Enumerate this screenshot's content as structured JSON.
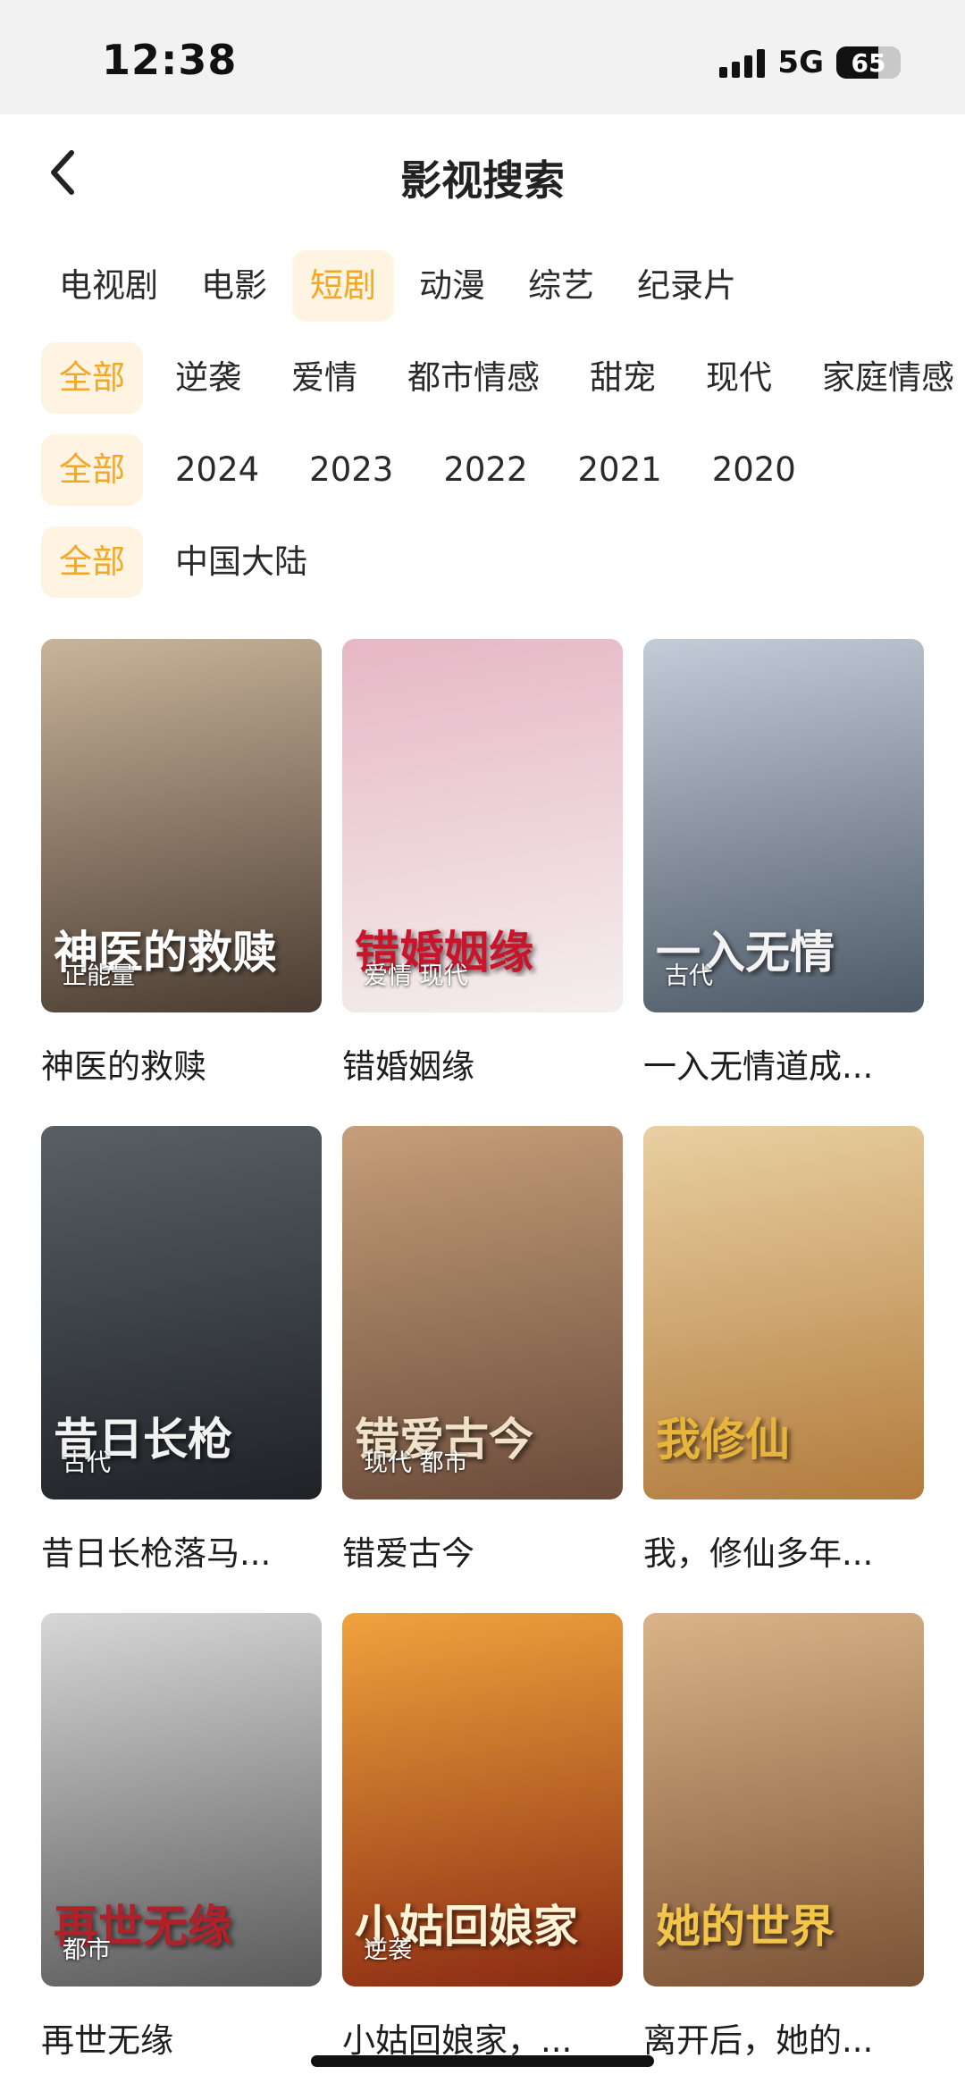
{
  "status": {
    "time": "12:38",
    "network": "5G",
    "battery": "65",
    "battery_level": 0.65
  },
  "header": {
    "title": "影视搜索",
    "back_icon": "chevron-left-icon"
  },
  "filters": {
    "category": [
      "电视剧",
      "电影",
      "短剧",
      "动漫",
      "综艺",
      "纪录片"
    ],
    "category_active": 2,
    "genre": [
      "全部",
      "逆袭",
      "爱情",
      "都市情感",
      "甜宠",
      "现代",
      "家庭情感"
    ],
    "genre_active": 0,
    "year": [
      "全部",
      "2024",
      "2023",
      "2022",
      "2021",
      "2020"
    ],
    "year_active": 0,
    "region": [
      "全部",
      "中国大陆"
    ],
    "region_active": 0
  },
  "accent_color": "#f5a623",
  "items": [
    {
      "name": "神医的救赎",
      "poster_title": "神医的救赎",
      "tag": "正能量",
      "colors": [
        "#c9b49a",
        "#4a3c32"
      ],
      "title_color": "#ffffff"
    },
    {
      "name": "错婚姻缘",
      "poster_title": "错婚姻缘",
      "tag": "爱情 现代",
      "colors": [
        "#e7b7c6",
        "#f4eeee"
      ],
      "title_color": "#c8152a"
    },
    {
      "name": "一入无情道成...",
      "poster_title": "一入无情",
      "tag": "古代",
      "colors": [
        "#c3cdd8",
        "#4d5966"
      ],
      "title_color": "#f4f4f4"
    },
    {
      "name": "昔日长枪落马...",
      "poster_title": "昔日长枪",
      "tag": "古代",
      "colors": [
        "#586066",
        "#1f2226"
      ],
      "title_color": "#f2f2f2"
    },
    {
      "name": "错爱古今",
      "poster_title": "错爱古今",
      "tag": "现代 都市",
      "colors": [
        "#c69f79",
        "#6a4a3a"
      ],
      "title_color": "#f0e2c8"
    },
    {
      "name": "我，修仙多年...",
      "poster_title": "我修仙",
      "tag": "",
      "colors": [
        "#e9d0a2",
        "#b27b3c"
      ],
      "title_color": "#e8b53c"
    },
    {
      "name": "再世无缘",
      "poster_title": "再世无缘",
      "tag": "都市",
      "colors": [
        "#d7d7d7",
        "#5a5a5a"
      ],
      "title_color": "#b0212a"
    },
    {
      "name": "小姑回娘家，...",
      "poster_title": "小姑回娘家",
      "tag": "逆袭",
      "colors": [
        "#f0a33d",
        "#8a2a12"
      ],
      "title_color": "#fff4d8"
    },
    {
      "name": "离开后，她的...",
      "poster_title": "她的世界",
      "tag": "",
      "colors": [
        "#d9b487",
        "#7a5236"
      ],
      "title_color": "#f3c54a"
    }
  ]
}
